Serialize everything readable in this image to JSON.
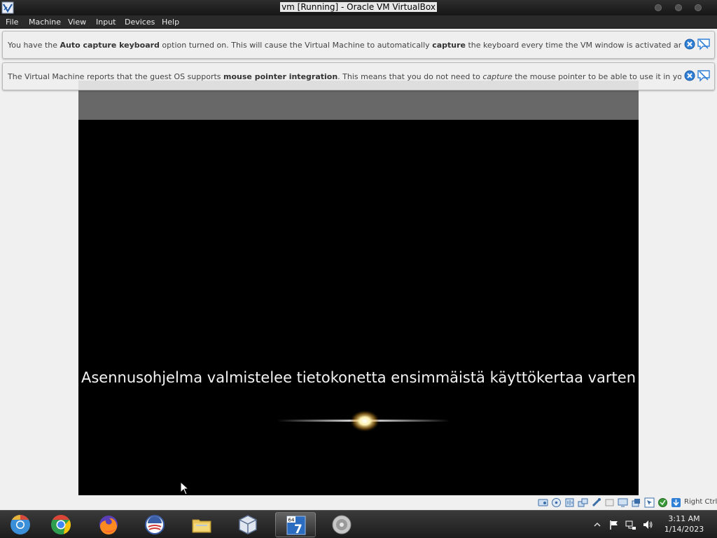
{
  "window": {
    "title": "vm [Running] - Oracle VM VirtualBox"
  },
  "menu": {
    "items": [
      {
        "label": "File"
      },
      {
        "label": "Machine"
      },
      {
        "label": "View"
      },
      {
        "label": "Input"
      },
      {
        "label": "Devices"
      },
      {
        "label": "Help"
      }
    ]
  },
  "notifications": [
    {
      "t1": "You have the ",
      "b1": "Auto capture keyboard",
      "t2": " option turned on. This will cause the Virtual Machine to automatically ",
      "b2": "capture",
      "t3": " the keyboard every time the VM window is activated and make it unavailable to"
    },
    {
      "t1": "The Virtual Machine reports that the guest OS supports ",
      "b1": "mouse pointer integration",
      "t2": ". This means that you do not need to ",
      "i1": "capture",
      "t3": " the mouse pointer to be able to use it in your guest OS -- all mouse"
    }
  ],
  "guest": {
    "setup_text": "Asennusohjelma valmistelee tietokonetta ensimmäistä käyttökertaa varten"
  },
  "statusbar": {
    "icons": [
      "hard-disk-icon",
      "optical-drive-icon",
      "audio-icon",
      "network-icon",
      "usb-icon",
      "shared-folders-icon",
      "display-icon",
      "video-capture-icon",
      "mouse-integration-icon",
      "recording-icon",
      "cpu-icon",
      "guest-additions-icon",
      "download-icon"
    ],
    "host_key": "Right Ctrl"
  },
  "taskbar": {
    "apps": [
      {
        "name": "chromium",
        "icon": "chromium-icon"
      },
      {
        "name": "chrome",
        "icon": "chrome-icon"
      },
      {
        "name": "firefox",
        "icon": "firefox-icon"
      },
      {
        "name": "obama-app",
        "icon": "obama-logo-icon"
      },
      {
        "name": "file-explorer",
        "icon": "folder-icon"
      },
      {
        "name": "virtualbox",
        "icon": "virtualbox-icon"
      },
      {
        "name": "win7-usb-tool",
        "icon": "win7-64-icon",
        "badge": "64",
        "digit": "7"
      },
      {
        "name": "speaker-app",
        "icon": "speaker-icon"
      }
    ],
    "tray": {
      "time": "3:11 AM",
      "date": "1/14/2023"
    }
  },
  "colors": {
    "titlebar": "#1f1f1f",
    "guest_bg": "#000000",
    "taskbar": "#2a2a2a",
    "notice_bg": "#eeeeee"
  }
}
